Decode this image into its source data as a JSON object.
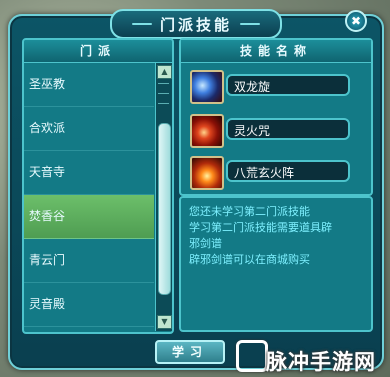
{
  "title": "门派技能",
  "close_label": "✖",
  "left_panel": {
    "header": "门派",
    "items": [
      {
        "label": "圣巫教"
      },
      {
        "label": "合欢派"
      },
      {
        "label": "天音寺"
      },
      {
        "label": "焚香谷"
      },
      {
        "label": "青云门"
      },
      {
        "label": "灵音殿"
      }
    ],
    "selected_index": 3
  },
  "right_panel": {
    "header": "技能名称",
    "skills": [
      {
        "name": "双龙旋",
        "icon": "blue-dragon-skill-icon"
      },
      {
        "name": "灵火咒",
        "icon": "fire-orb-skill-icon"
      },
      {
        "name": "八荒玄火阵",
        "icon": "flame-array-skill-icon"
      }
    ]
  },
  "description": {
    "lines": [
      "您还未学习第二门派技能",
      "学习第二门派技能需要道具辟",
      "邪剑谱",
      "辟邪剑谱可以在商城购买"
    ]
  },
  "learn_button": "学习",
  "watermark": "脉冲手游网",
  "colors": {
    "panel_bg": "#137a86",
    "border": "#4dc4cc",
    "selected_item": "#5aa85c",
    "description_text": "#7ef0ff"
  }
}
